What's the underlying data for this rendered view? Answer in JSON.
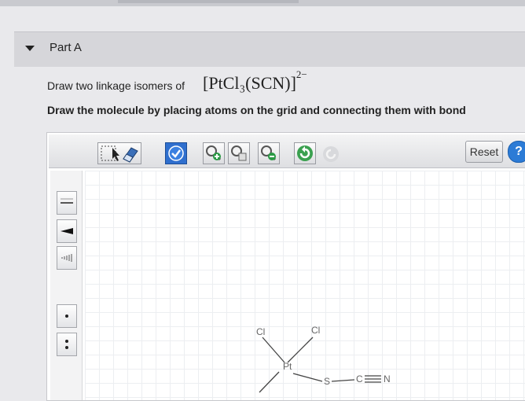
{
  "part": {
    "title": "Part A"
  },
  "instruction": {
    "line1": "Draw two linkage isomers of",
    "formula_main": "[PtCl₃(SCN)]",
    "formula_charge": "2−",
    "line2": "Draw the molecule by placing atoms on the grid and connecting them with bond"
  },
  "toolbar": {
    "reset_label": "Reset",
    "help_label": "?"
  },
  "molecule": {
    "atoms": [
      "Cl",
      "Cl",
      "Pt",
      "S",
      "C",
      "N"
    ]
  },
  "icons": {
    "select": "select-arrow-icon",
    "eraser": "eraser-icon",
    "check": "check-icon",
    "zoom_in": "zoom-in-icon",
    "zoom_fit": "zoom-fit-icon",
    "zoom_out": "zoom-out-icon",
    "undo": "undo-icon",
    "redo": "redo-icon"
  },
  "colors": {
    "accent": "#2c7bd6",
    "check_bg": "#2f6fce",
    "zoom_green": "#2a9a44"
  }
}
